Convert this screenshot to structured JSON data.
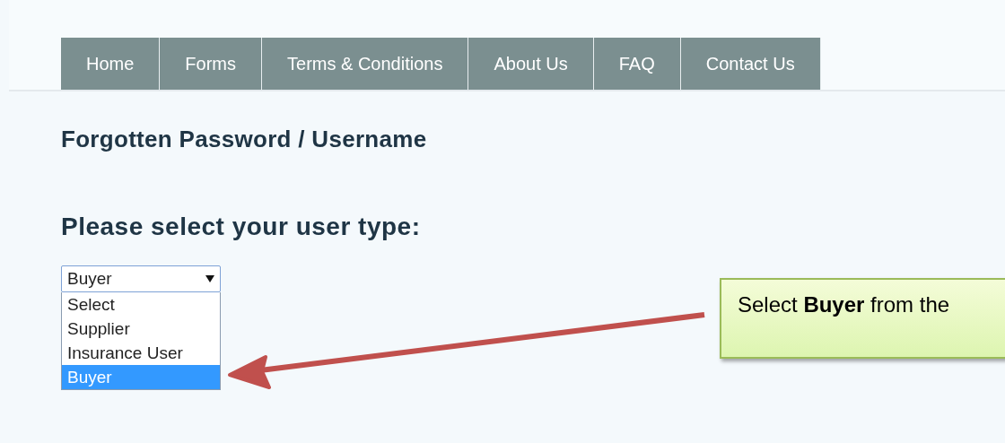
{
  "nav": [
    {
      "label": "Home"
    },
    {
      "label": "Forms"
    },
    {
      "label": "Terms & Conditions"
    },
    {
      "label": "About Us"
    },
    {
      "label": "FAQ"
    },
    {
      "label": "Contact Us"
    }
  ],
  "title": "Forgotten Password / Username",
  "prompt": "Please select your user type:",
  "user_type_select": {
    "value": "Buyer",
    "expanded": true,
    "options": [
      {
        "label": "Select",
        "selected": false
      },
      {
        "label": "Supplier",
        "selected": false
      },
      {
        "label": "Insurance User",
        "selected": false
      },
      {
        "label": "Buyer",
        "selected": true
      }
    ]
  },
  "callout": {
    "text": "Select **Buyer** from the"
  }
}
